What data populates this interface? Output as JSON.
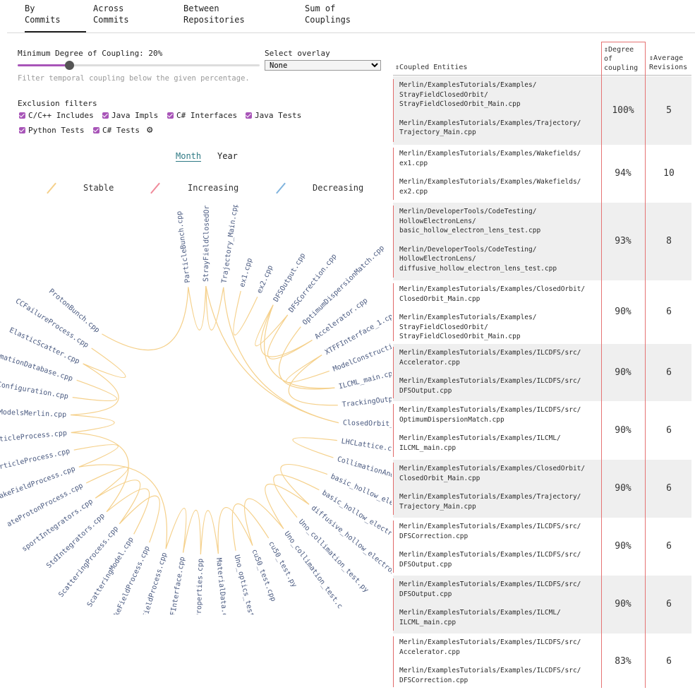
{
  "tabs": [
    {
      "line1": "By",
      "line2": "Commits"
    },
    {
      "line1": "Across",
      "line2": "Commits"
    },
    {
      "line1": "Between",
      "line2": "Repositories"
    },
    {
      "line1": "Sum of",
      "line2": "Couplings"
    }
  ],
  "filter": {
    "min_label": "Minimum Degree of Coupling: 20%",
    "min_value": 0.2,
    "hint": "Filter temporal coupling below the given percentage.",
    "overlay_label": "Select overlay",
    "overlay_value": "None"
  },
  "exclusions": {
    "title": "Exclusion filters",
    "items": [
      "C/C++ Includes",
      "Java Impls",
      "C# Interfaces",
      "Java Tests",
      "Python Tests",
      "C# Tests"
    ]
  },
  "period": {
    "month": "Month",
    "year": "Year"
  },
  "legend": [
    {
      "label": "Stable",
      "color": "#f5d08a"
    },
    {
      "label": "Increasing",
      "color": "#f08a9a"
    },
    {
      "label": "Decreasing",
      "color": "#7fb3dd"
    }
  ],
  "bundle_nodes": [
    "ParticleBunch.cpp",
    "StrayFieldClosedOrbi",
    "Trajectory_Main.cpp",
    "ex1.cpp",
    "ex2.cpp",
    "DFSOutput.cpp",
    "DFSCorrection.cpp",
    "OptimumDispersionMatch.cpp",
    "Accelerator.cpp",
    "XTFFInterface_1.cpp",
    "ModelConstruction.cp",
    "ILCML_main.cpp",
    "TrackingOutput.cpp",
    "ClosedOrbit_Main.cpp",
    "LHCLattice.cpp",
    "CollimationAndScattering.cpp",
    "basic_hollow_electron_lens_test.c",
    "basic_hollow_electron_lens_test.p",
    "diffusive_hollow_electron_l",
    "Uno_collimation_test.py",
    "Uno_collimation_test.c",
    "cu50_test.py",
    "cu50_test.cpp",
    "Uno_optics_test.cpp",
    "MaterialData.cpp",
    "MaterialProperties.cpp",
    "XTFFInterface.cpp",
    "CouplerWakeFieldProcess.cpp",
    "WakeFieldProcess.cpp",
    "ScatteringModel.cpp",
    "ScatteringProcess.cpp",
    "StdIntegrators.cpp",
    "sportIntegrators.cpp",
    "ateProtonProcess.cpp",
    "WakeFieldProcess.cpp",
    "teParticleProcess.cpp",
    "chRadParticleProcess.cpp",
    "ScatteringModelsMerlin.cpp",
    "ApertureConfiguration.cpp",
    "CollimationDatabase.cpp",
    "ElasticScatter.cpp",
    "CCFailureProcess.cpp",
    "ProtonBunch.cpp"
  ],
  "table": {
    "headers": {
      "entities": "Coupled Entities",
      "degree": [
        "Degree",
        "of",
        "coupling"
      ],
      "revisions": [
        "Average",
        "Revisions"
      ]
    },
    "rows": [
      {
        "a": "Merlin/ExamplesTutorials/Examples/\nStrayFieldClosedOrbit/\nStrayFieldClosedOrbit_Main.cpp",
        "b": "Merlin/ExamplesTutorials/Examples/Trajectory/\nTrajectory_Main.cpp",
        "degree": "100%",
        "revisions": "5"
      },
      {
        "a": "Merlin/ExamplesTutorials/Examples/Wakefields/\nex1.cpp",
        "b": "Merlin/ExamplesTutorials/Examples/Wakefields/\nex2.cpp",
        "degree": "94%",
        "revisions": "10"
      },
      {
        "a": "Merlin/DeveloperTools/CodeTesting/\nHollowElectronLens/\nbasic_hollow_electron_lens_test.cpp",
        "b": "Merlin/DeveloperTools/CodeTesting/\nHollowElectronLens/\ndiffusive_hollow_electron_lens_test.cpp",
        "degree": "93%",
        "revisions": "8"
      },
      {
        "a": "Merlin/ExamplesTutorials/Examples/ClosedOrbit/\nClosedOrbit_Main.cpp",
        "b": "Merlin/ExamplesTutorials/Examples/\nStrayFieldClosedOrbit/\nStrayFieldClosedOrbit_Main.cpp",
        "degree": "90%",
        "revisions": "6"
      },
      {
        "a": "Merlin/ExamplesTutorials/Examples/ILCDFS/src/\nAccelerator.cpp",
        "b": "Merlin/ExamplesTutorials/Examples/ILCDFS/src/\nDFSOutput.cpp",
        "degree": "90%",
        "revisions": "6"
      },
      {
        "a": "Merlin/ExamplesTutorials/Examples/ILCDFS/src/\nOptimumDispersionMatch.cpp",
        "b": "Merlin/ExamplesTutorials/Examples/ILCML/\nILCML_main.cpp",
        "degree": "90%",
        "revisions": "6"
      },
      {
        "a": "Merlin/ExamplesTutorials/Examples/ClosedOrbit/\nClosedOrbit_Main.cpp",
        "b": "Merlin/ExamplesTutorials/Examples/Trajectory/\nTrajectory_Main.cpp",
        "degree": "90%",
        "revisions": "6"
      },
      {
        "a": "Merlin/ExamplesTutorials/Examples/ILCDFS/src/\nDFSCorrection.cpp",
        "b": "Merlin/ExamplesTutorials/Examples/ILCDFS/src/\nDFSOutput.cpp",
        "degree": "90%",
        "revisions": "6"
      },
      {
        "a": "Merlin/ExamplesTutorials/Examples/ILCDFS/src/\nDFSOutput.cpp",
        "b": "Merlin/ExamplesTutorials/Examples/ILCML/\nILCML_main.cpp",
        "degree": "90%",
        "revisions": "6"
      },
      {
        "a": "Merlin/ExamplesTutorials/Examples/ILCDFS/src/\nAccelerator.cpp",
        "b": "Merlin/ExamplesTutorials/Examples/ILCDFS/src/\nDFSCorrection.cpp",
        "degree": "83%",
        "revisions": "6"
      }
    ]
  }
}
